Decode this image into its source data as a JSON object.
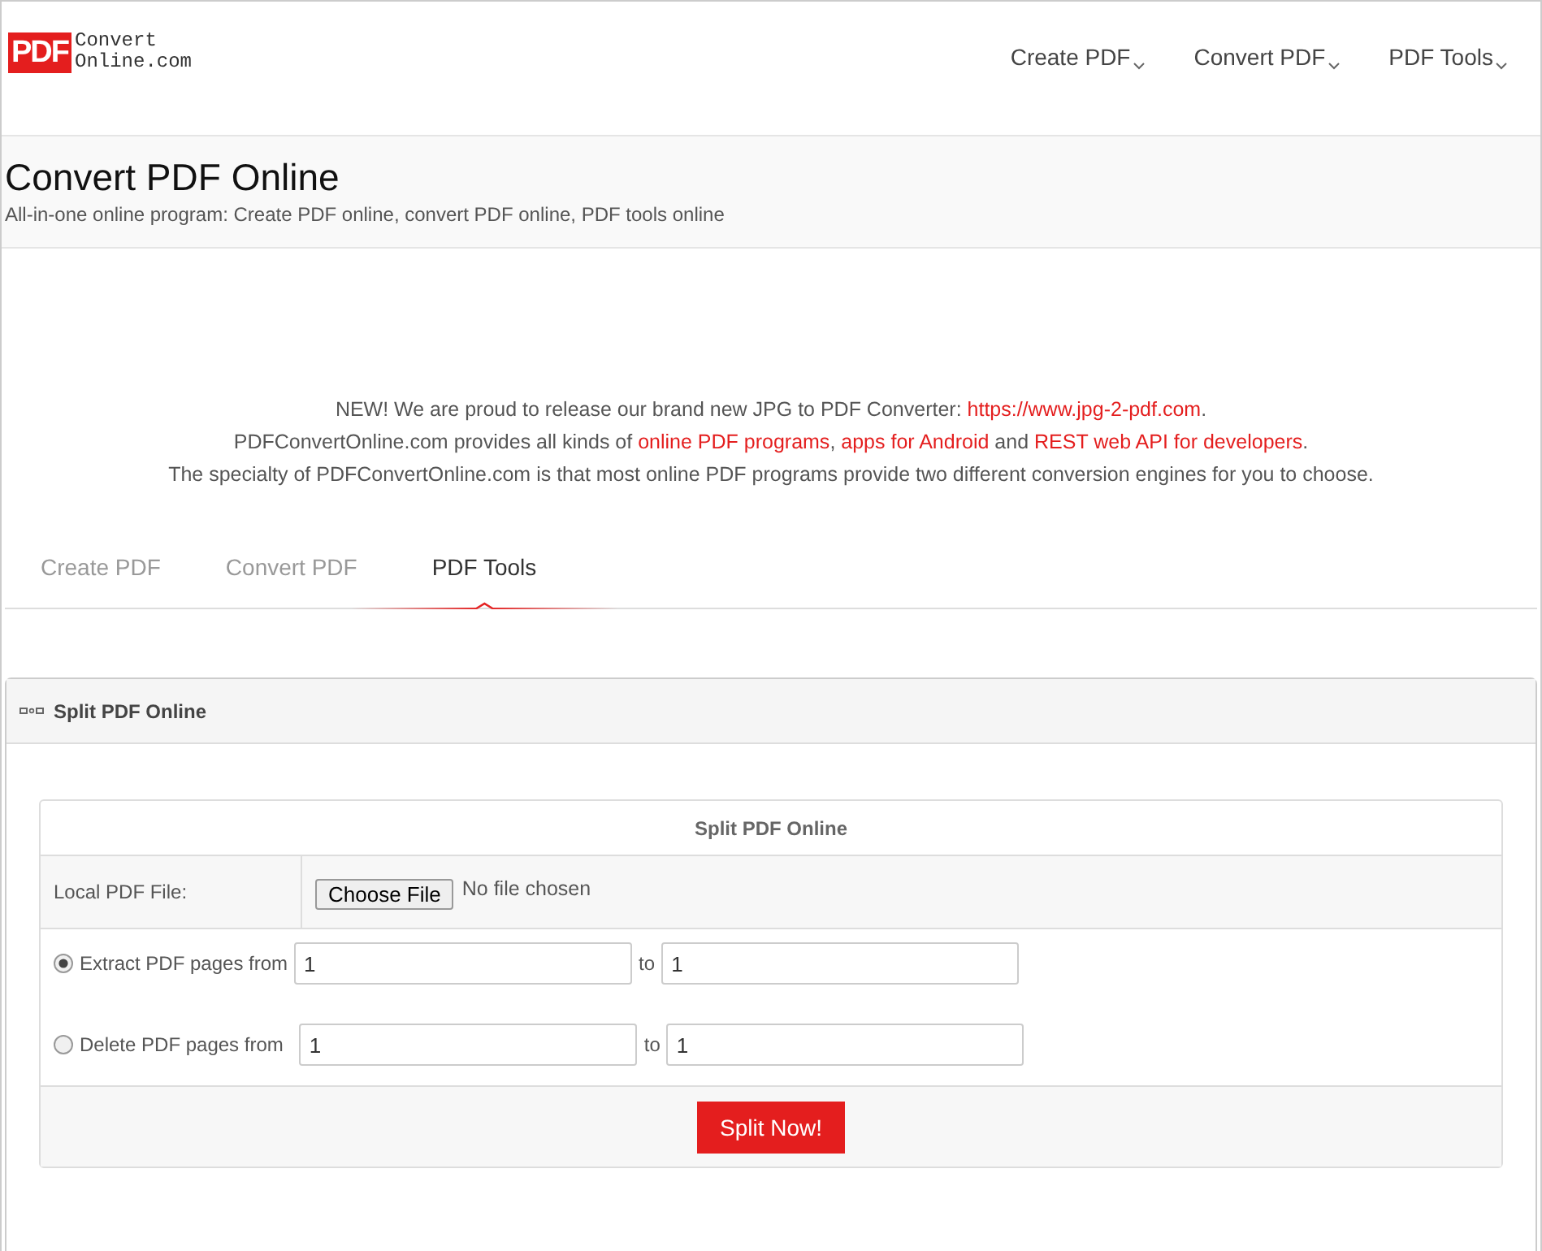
{
  "logo": {
    "badge": "PDF",
    "line1": "Convert",
    "line2": "Online.com"
  },
  "nav": [
    {
      "label": "Create PDF"
    },
    {
      "label": "Convert PDF"
    },
    {
      "label": "PDF Tools"
    }
  ],
  "banner": {
    "title": "Convert PDF Online",
    "subtitle": "All-in-one online program: Create PDF online, convert PDF online, PDF tools online"
  },
  "intro": [
    [
      {
        "text": "NEW! We are proud to release our brand new JPG to PDF Converter: ",
        "link": false
      },
      {
        "text": "https://www.jpg-2-pdf.com",
        "link": true
      },
      {
        "text": ".",
        "link": false
      }
    ],
    [
      {
        "text": "PDFConvertOnline.com provides all kinds of ",
        "link": false
      },
      {
        "text": "online PDF programs",
        "link": true
      },
      {
        "text": ", ",
        "link": false
      },
      {
        "text": "apps for Android",
        "link": true
      },
      {
        "text": " and ",
        "link": false
      },
      {
        "text": "REST web API for developers",
        "link": true
      },
      {
        "text": ".",
        "link": false
      }
    ],
    [
      {
        "text": "The specialty of PDFConvertOnline.com is that most online PDF programs provide two different conversion engines for you to choose.",
        "link": false
      }
    ]
  ],
  "tabs": [
    {
      "label": "Create PDF",
      "selected": false
    },
    {
      "label": "Convert PDF",
      "selected": false
    },
    {
      "label": "PDF Tools",
      "selected": true
    }
  ],
  "panel": {
    "title": "Split PDF Online",
    "form": {
      "title": "Split PDF Online",
      "file_label": "Local PDF File:",
      "file_button": "Choose File",
      "file_status": "No file chosen",
      "options": [
        {
          "label": "Extract PDF pages from",
          "selected": true,
          "from": "1",
          "to_label": "to",
          "to": "1"
        },
        {
          "label": "Delete PDF pages from",
          "selected": false,
          "from": "1",
          "to_label": "to",
          "to": "1"
        }
      ],
      "submit": "Split Now!"
    }
  }
}
